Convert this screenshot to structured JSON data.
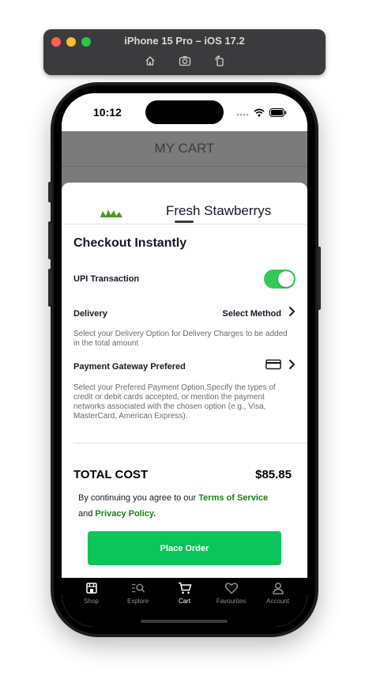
{
  "simulator": {
    "title": "iPhone 15 Pro – iOS 17.2",
    "tools": [
      "home-icon",
      "screenshot-icon",
      "rotate-icon"
    ]
  },
  "status_bar": {
    "time": "10:12"
  },
  "header": {
    "title": "MY CART"
  },
  "cart_item_peek": {
    "name": "Fresh Stawberrys"
  },
  "checkout": {
    "title": "Checkout Instantly",
    "upi": {
      "label": "UPI Transaction",
      "enabled": true
    },
    "delivery": {
      "label": "Delivery",
      "value": "Select Method",
      "description": "Select your Delivery Option for Delivery Charges to be added in the total amount"
    },
    "payment": {
      "label": "Payment Gateway Prefered",
      "description": "Select your Prefered Payment Option.Specify the types of credit or debit cards accepted, or mention the payment networks associated with the chosen option (e.g., Visa, MasterCard, American Express)."
    },
    "total": {
      "label": "TOTAL COST",
      "value": "$85.85"
    },
    "terms": {
      "prefix": "By continuing you agree to our",
      "terms_link": "Terms of Service",
      "and": "and",
      "privacy_link": "Privacy Policy."
    },
    "place_order": "Place Order"
  },
  "tabs": [
    {
      "label": "Shop",
      "icon": "shop-icon",
      "active": false
    },
    {
      "label": "Explore",
      "icon": "explore-icon",
      "active": false
    },
    {
      "label": "Cart",
      "icon": "cart-icon",
      "active": true
    },
    {
      "label": "Favourites",
      "icon": "heart-icon",
      "active": false
    },
    {
      "label": "Account",
      "icon": "account-icon",
      "active": false
    }
  ],
  "colors": {
    "accent_green": "#0cc55a",
    "toggle_green": "#34c759",
    "link_green": "#1a7f1a"
  }
}
